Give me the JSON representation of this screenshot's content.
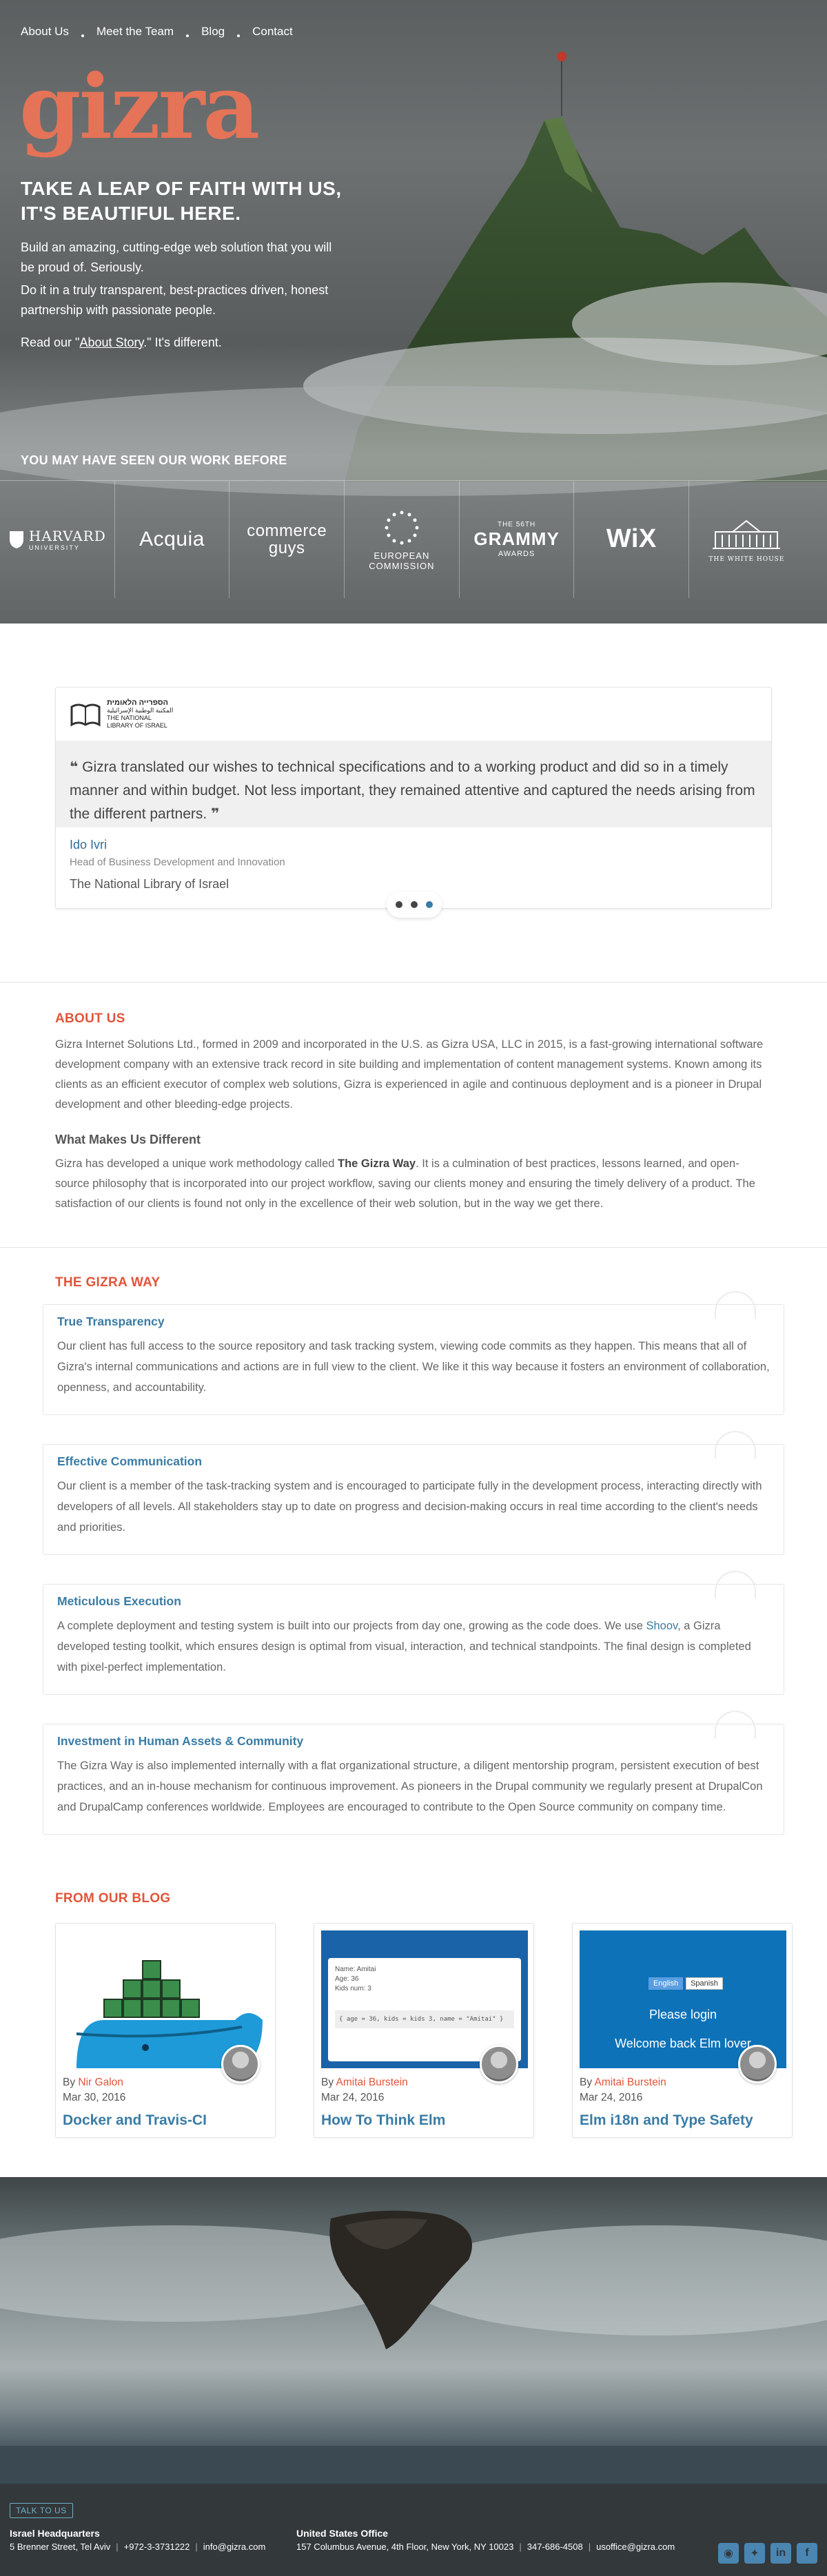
{
  "nav": {
    "items": [
      "About Us",
      "Meet the Team",
      "Blog",
      "Contact"
    ]
  },
  "hero": {
    "logo": "gizra",
    "tagline_1": "TAKE A LEAP OF FAITH WITH US,",
    "tagline_2": "IT'S BEAUTIFUL HERE.",
    "intro_1": "Build an amazing, cutting-edge web solution that you will be proud of. Seriously.",
    "intro_2": "Do it in a truly transparent, best-practices driven, honest partnership with passionate people.",
    "read_prefix": "Read our \"",
    "read_link": "About Story",
    "read_suffix": ".\" It's different."
  },
  "clients": {
    "title": "YOU MAY HAVE SEEN OUR WORK BEFORE",
    "harvard": "HARVARD",
    "harvard_sub": "UNIVERSITY",
    "acquia": "Acquia",
    "commerce_1": "commerce",
    "commerce_2": "guys",
    "ec_1": "EUROPEAN",
    "ec_2": "COMMISSION",
    "grammy_top": "THE 56TH",
    "grammy": "GRAMMY",
    "grammy_sub": "AWARDS",
    "wix": "WiX",
    "whitehouse": "THE WHITE HOUSE"
  },
  "testimonial": {
    "logo_he": "הספרייה הלאומית",
    "logo_ar": "المكتبة الوطنية الإسرائيلية",
    "logo_en_1": "THE NATIONAL",
    "logo_en_2": "LIBRARY OF ISRAEL",
    "quote": "Gizra translated our wishes to technical specifications and to a working product and did so in a timely manner and within budget. Not less important, they remained attentive and captured the needs arising from the different partners.",
    "name": "Ido Ivri",
    "role": "Head of Business Development and Innovation",
    "org": "The National Library of Israel"
  },
  "about": {
    "title": "ABOUT US",
    "text": "Gizra Internet Solutions Ltd., formed in 2009 and incorporated in the U.S. as Gizra USA, LLC in 2015, is a fast-growing international software development company with an extensive track record in site building and implementation of content management systems. Known among its clients as an efficient executor of complex web solutions, Gizra is experienced in agile and continuous deployment and is a pioneer in Drupal development and other bleeding-edge projects.",
    "subtitle": "What Makes Us Different",
    "diff_1": "Gizra has developed a unique work methodology called ",
    "diff_bold": "The Gizra Way",
    "diff_2": ". It is a culmination of best practices, lessons learned, and open-source philosophy that is incorporated into our project workflow, saving our clients money and ensuring the timely delivery of a product. The satisfaction of our clients is found not only in the excellence of their web solution, but in the way we get there."
  },
  "way": {
    "title": "THE GIZRA WAY",
    "cards": [
      {
        "title": "True Transparency",
        "text": "Our client has full access to the source repository and task tracking system, viewing code commits as they happen. This means that all of Gizra's internal communications and actions are in full view to the client. We like it this way because it fosters an environment of collaboration, openness, and accountability."
      },
      {
        "title": "Effective Communication",
        "text": "Our client is a member of the task-tracking system and is encouraged to participate fully in the development process, interacting directly with developers of all levels. All stakeholders stay up to date on progress and decision-making occurs in real time according to the client's needs and priorities."
      },
      {
        "title": "Meticulous Execution",
        "text_1": "A complete deployment and testing system is built into our projects from day one, growing as the code does. We use ",
        "link": "Shoov",
        "text_2": ", a Gizra developed testing toolkit, which ensures design is optimal from visual, interaction, and technical standpoints. The final design is completed with pixel-perfect implementation."
      },
      {
        "title": "Investment in Human Assets & Community",
        "text": "The Gizra Way is also implemented internally with a flat organizational structure, a diligent mentorship program, persistent execution of best practices, and an in-house mechanism for continuous improvement. As pioneers in the Drupal community we regularly present at DrupalCon and DrupalCamp conferences worldwide. Employees are encouraged to contribute to the Open Source community on company time."
      }
    ]
  },
  "blog": {
    "title": "FROM OUR BLOG",
    "by": "By ",
    "posts": [
      {
        "author": "Nir Galon",
        "date": "Mar 30, 2016",
        "title": "Docker and Travis-CI"
      },
      {
        "author": "Amitai Burstein",
        "date": "Mar 24, 2016",
        "title": "How To Think Elm"
      },
      {
        "author": "Amitai Burstein",
        "date": "Mar 24, 2016",
        "title": "Elm i18n and Type Safety"
      }
    ],
    "elm_code": {
      "name": "Name: Amitai",
      "age": "Age: 36",
      "kids": "Kids num: 3",
      "code": "{ age = 36, kids = kids 3, name = \"Amitai\" }"
    },
    "elm_i18n": {
      "lang_1": "English",
      "lang_2": "Spanish",
      "line_1": "Please login",
      "line_2": "Welcome back Elm lover"
    }
  },
  "footer": {
    "talk": "TALK TO US",
    "il_title": "Israel Headquarters",
    "il_address": "5 Brenner Street, Tel Aviv",
    "il_phone": "+972-3-3731222",
    "il_email": "info@gizra.com",
    "us_title": "United States Office",
    "us_address": "157 Columbus Avenue, 4th Floor, New York, NY 10023",
    "us_phone": "347-686-4508",
    "us_email": "usoffice@gizra.com",
    "social": [
      "github-icon",
      "twitter-icon",
      "linkedin-icon",
      "facebook-icon"
    ]
  }
}
